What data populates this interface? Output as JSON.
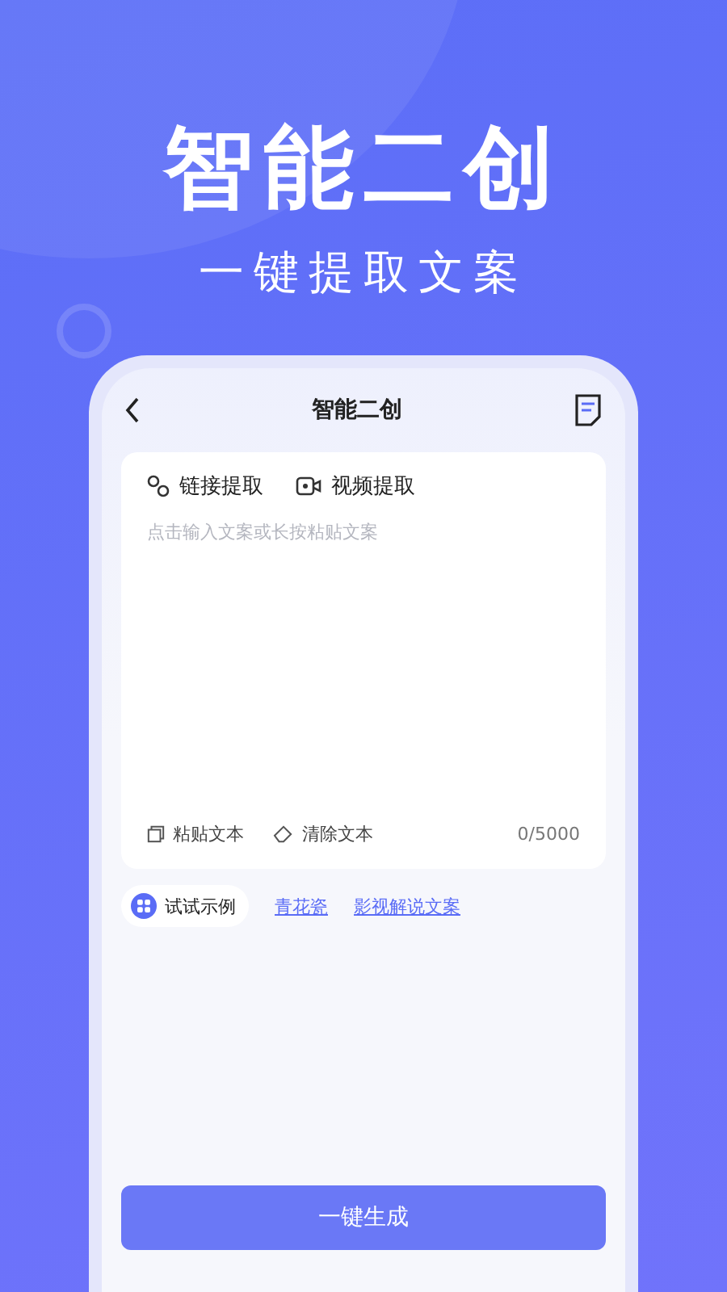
{
  "hero": {
    "title": "智能二创",
    "subtitle": "一键提取文案"
  },
  "phone": {
    "title": "智能二创",
    "sources": [
      {
        "kind": "link",
        "label": "链接提取"
      },
      {
        "kind": "video",
        "label": "视频提取"
      }
    ],
    "input": {
      "placeholder": "点击输入文案或长按粘贴文案"
    },
    "actions": [
      {
        "kind": "paste",
        "label": "粘贴文本"
      },
      {
        "kind": "clear",
        "label": "清除文本"
      }
    ],
    "counter": "0/5000",
    "examples": {
      "label": "试试示例",
      "links": [
        "青花瓷",
        "影视解说文案"
      ]
    },
    "generate_button": "一键生成"
  }
}
